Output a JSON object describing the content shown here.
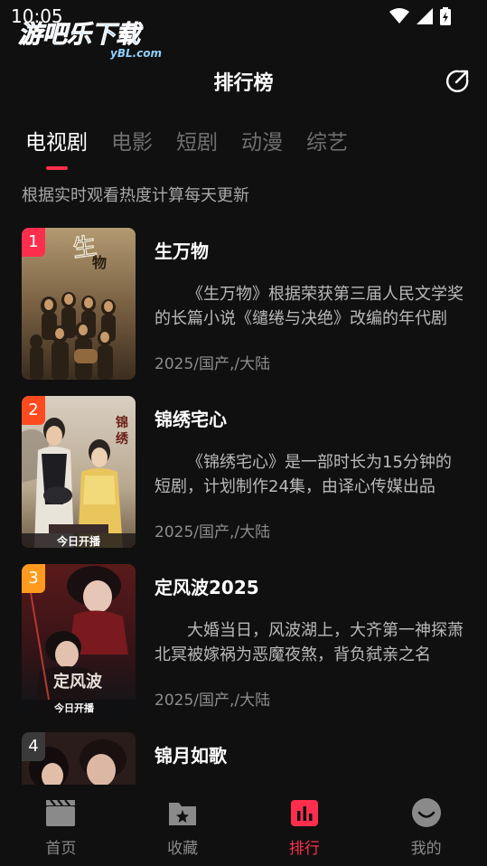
{
  "status_bar": {
    "time": "10:05"
  },
  "watermark": {
    "name": "游吧乐下载",
    "domain": "yBL.com"
  },
  "header": {
    "title": "排行榜"
  },
  "tabs": [
    {
      "label": "电视剧",
      "active": true
    },
    {
      "label": "电影",
      "active": false
    },
    {
      "label": "短剧",
      "active": false
    },
    {
      "label": "动漫",
      "active": false
    },
    {
      "label": "综艺",
      "active": false
    }
  ],
  "subtitle": "根据实时观看热度计算每天更新",
  "items": [
    {
      "rank": "1",
      "badge_color": "#ff2e4d",
      "title": "生万物",
      "desc": "《生万物》根据荣获第三届人民文学奖的长篇小说《缱绻与决绝》改编的年代剧",
      "meta": "2025/国产,/大陆"
    },
    {
      "rank": "2",
      "badge_color": "#ff4a1f",
      "title": "锦绣宅心",
      "desc": "《锦绣宅心》是一部时长为15分钟的短剧，计划制作24集，由译心传媒出品",
      "meta": "2025/国产,/大陆",
      "poster_text": "今日开播"
    },
    {
      "rank": "3",
      "badge_color": "#ff9a1f",
      "title": "定风波2025",
      "desc": "大婚当日，风波湖上，大齐第一神探萧北冥被嫁祸为恶魔夜煞，背负弑亲之名",
      "meta": "2025/国产,/大陆",
      "poster_text": "今日开播"
    },
    {
      "rank": "4",
      "badge_color": "#3a3a3a",
      "title": "锦月如歌",
      "desc": "",
      "meta": ""
    }
  ],
  "bottom_nav": [
    {
      "label": "首页",
      "icon": "clapperboard-icon",
      "active": false
    },
    {
      "label": "收藏",
      "icon": "bookmark-folder-icon",
      "active": false
    },
    {
      "label": "排行",
      "icon": "ranking-chart-icon",
      "active": true
    },
    {
      "label": "我的",
      "icon": "smiley-profile-icon",
      "active": false
    }
  ],
  "colors": {
    "accent": "#ff2e4d",
    "background": "#101010",
    "inactive": "#8a8a8a"
  }
}
